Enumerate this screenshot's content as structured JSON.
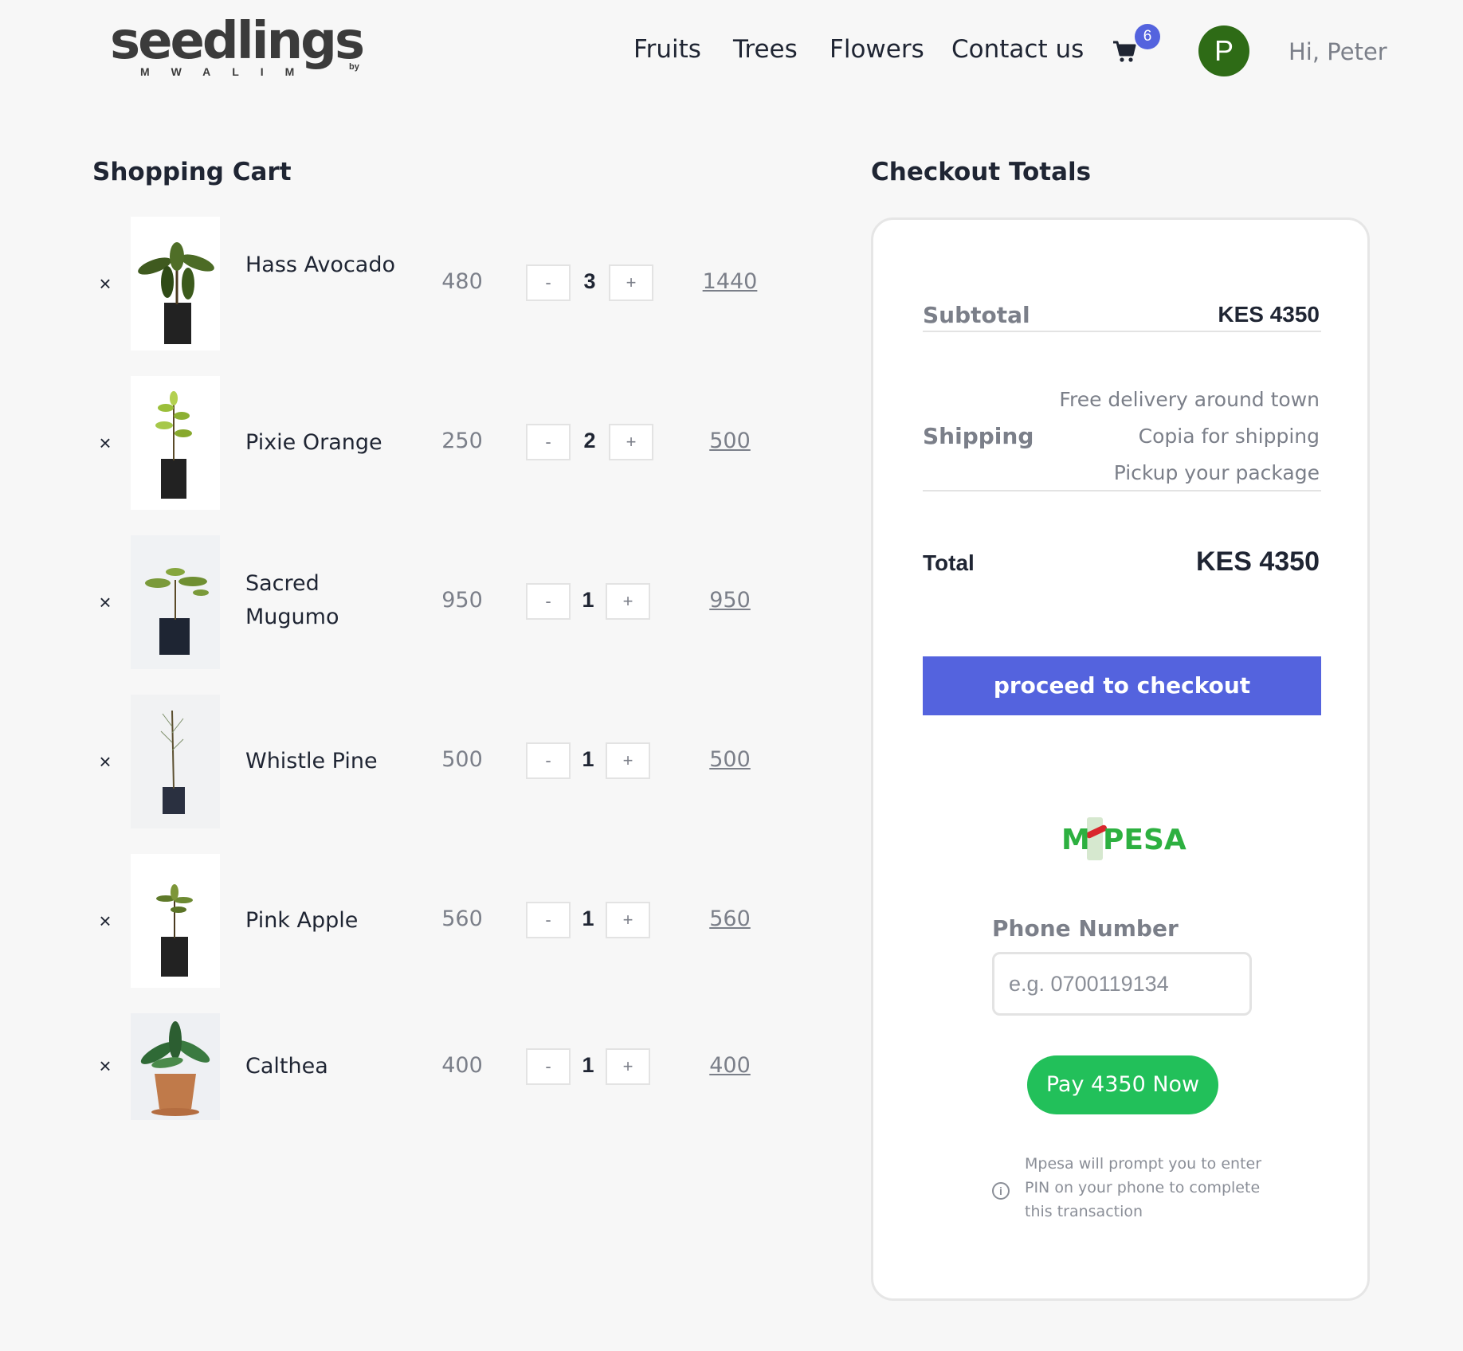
{
  "brand": {
    "name": "seedlings",
    "sub": "MWALIM",
    "by": "by"
  },
  "nav": {
    "items": [
      "Fruits",
      "Trees",
      "Flowers",
      "Contact us"
    ]
  },
  "cart_badge": "6",
  "user": {
    "initial": "P",
    "greeting": "Hi, Peter"
  },
  "cart": {
    "title": "Shopping Cart",
    "items": [
      {
        "name": "Hass Avocado",
        "price": "480",
        "qty": "3",
        "total": "1440",
        "plant": "avocado"
      },
      {
        "name": "Pixie Orange",
        "price": "250",
        "qty": "2",
        "total": "500",
        "plant": "orange"
      },
      {
        "name": "Sacred Mugumo",
        "price": "950",
        "qty": "1",
        "total": "950",
        "plant": "mugumo"
      },
      {
        "name": "Whistle Pine",
        "price": "500",
        "qty": "1",
        "total": "500",
        "plant": "pine"
      },
      {
        "name": "Pink Apple",
        "price": "560",
        "qty": "1",
        "total": "560",
        "plant": "apple"
      },
      {
        "name": "Calthea",
        "price": "400",
        "qty": "1",
        "total": "400",
        "plant": "calathea"
      }
    ],
    "minus_label": "-",
    "plus_label": "+",
    "remove_label": "×"
  },
  "checkout": {
    "title": "Checkout Totals",
    "subtotal_label": "Subtotal",
    "subtotal_value": "KES 4350",
    "shipping_label": "Shipping",
    "shipping_options": [
      "Free delivery around town",
      "Copia for shipping",
      "Pickup your package"
    ],
    "total_label": "Total",
    "total_value": "KES 4350",
    "checkout_button": "proceed to checkout",
    "mpesa_m": "M",
    "mpesa_pesa": "PESA",
    "phone_label": "Phone Number",
    "phone_placeholder": "e.g. 0700119134",
    "pay_button": "Pay 4350 Now",
    "info_text": "Mpesa will prompt you to enter PIN on your phone to complete this transaction"
  },
  "colors": {
    "accent": "#5463de",
    "pay": "#22c05a",
    "avatar": "#2e6b16",
    "mpesa_green": "#2db040"
  }
}
